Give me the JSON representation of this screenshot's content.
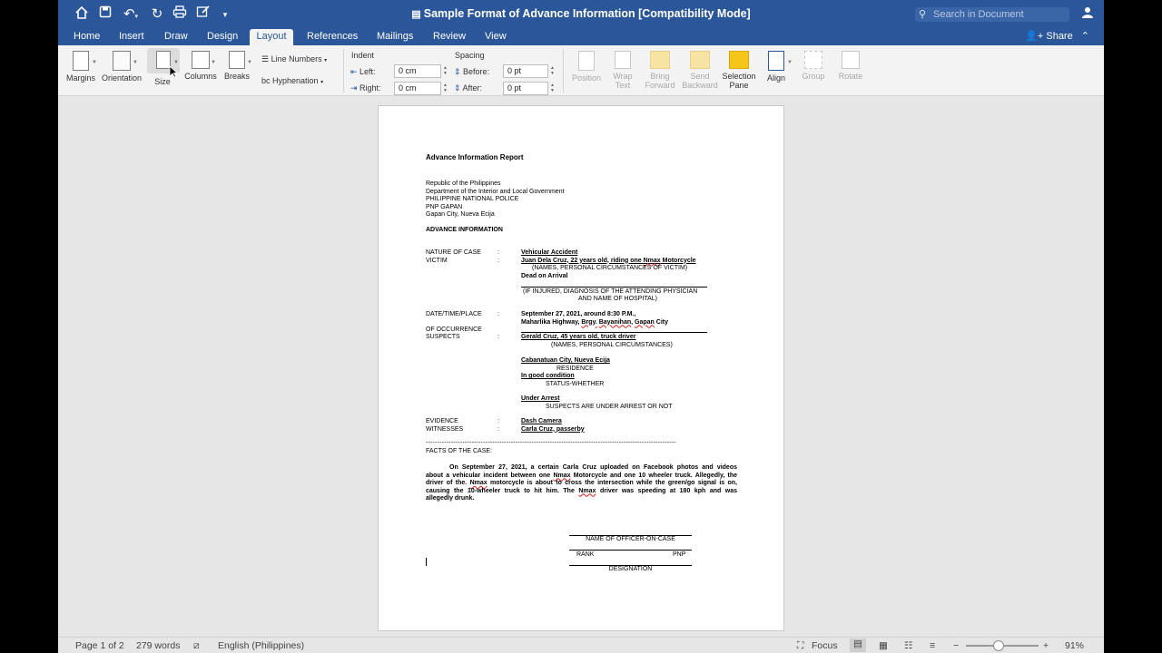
{
  "titlebar": {
    "doc_title": "Sample Format of Advance Information [Compatibility Mode]",
    "search_placeholder": "Search in Document"
  },
  "tabs": [
    {
      "label": "Home"
    },
    {
      "label": "Insert"
    },
    {
      "label": "Draw"
    },
    {
      "label": "Design"
    },
    {
      "label": "Layout",
      "active": true
    },
    {
      "label": "References"
    },
    {
      "label": "Mailings"
    },
    {
      "label": "Review"
    },
    {
      "label": "View"
    }
  ],
  "share_label": "Share",
  "ribbon": {
    "margins": "Margins",
    "orientation": "Orientation",
    "size": "Size",
    "columns": "Columns",
    "breaks": "Breaks",
    "line_numbers": "Line Numbers",
    "hyphenation": "Hyphenation",
    "indent": {
      "title": "Indent",
      "left_label": "Left:",
      "left_value": "0 cm",
      "right_label": "Right:",
      "right_value": "0 cm"
    },
    "spacing": {
      "title": "Spacing",
      "before_label": "Before:",
      "before_value": "0 pt",
      "after_label": "After:",
      "after_value": "0 pt"
    },
    "position": "Position",
    "wrap_text_1": "Wrap",
    "wrap_text_2": "Text",
    "bring_forward_1": "Bring",
    "bring_forward_2": "Forward",
    "send_backward_1": "Send",
    "send_backward_2": "Backward",
    "selection_pane_1": "Selection",
    "selection_pane_2": "Pane",
    "align": "Align",
    "group": "Group",
    "rotate": "Rotate"
  },
  "document": {
    "heading": "Advance Information Report",
    "address": [
      "Republic of the Philippines",
      "Department of the Interior and Local Government",
      "PHILIPPINE NATIONAL POLICE",
      "PNP GAPAN",
      "Gapan City, Nueva Ecija"
    ],
    "section_title": "ADVANCE INFORMATION",
    "colon": ":",
    "nature_label": "NATURE OF CASE",
    "nature_value": "Vehicular Accident",
    "victim_label": "VICTIM",
    "victim_value_a": "Juan Dela Cruz, 22 years old, riding one ",
    "nmax": "Nmax",
    "victim_value_b": " Motorcycle",
    "victim_caption": "(NAMES, PERSONAL CIRCUMSTANCES OF VICTIM)",
    "victim_status": "Dead on Arrival",
    "injury_caption_1": "(IF INJURED, DIAGNOSIS OF THE ATTENDING PHYSICIAN",
    "injury_caption_2": "AND NAME OF HOSPITAL)",
    "dtp_label": "DATE/TIME/PLACE",
    "dtp_value_1": "September 27, 2021, around 8:30 P.M.,",
    "dtp_value_2a": "Maharlika Highway, ",
    "brgy": "Brgy.",
    "bayanihan": "Bayanihan",
    "gapan": "Gapan",
    "dtp_value_2b": " City",
    "occurrence_label": "OF OCCURRENCE",
    "suspects_label": "SUSPECTS",
    "suspects_value": "Gerald Cruz, 45 years old, truck driver",
    "suspects_caption": "(NAMES, PERSONAL CIRCUMSTANCES)",
    "residence_value": "Cabanatuan City, Nueva Ecija",
    "residence_caption": "RESIDENCE",
    "condition_value": "In good condition",
    "condition_caption": "STATUS-WHETHER",
    "arrest_value": "Under Arrest",
    "arrest_caption": "SUSPECTS ARE UNDER ARREST OR NOT",
    "evidence_label": "EVIDENCE",
    "evidence_value": "Dash Camera",
    "witnesses_label": "WITNESSES",
    "witnesses_value": "Carla Cruz, passerby",
    "dashes": "-------------------------------------------------------------------------------------------------------------",
    "facts_label": "FACTS OF THE CASE:",
    "facts_line_1": "On September 27, 2021, a certain Carla Cruz uploaded on Facebook photos and videos",
    "facts_line_2a": "about a vehicular incident between one ",
    "facts_line_2b": " Motorcycle and one 10 wheeler truck. Allegedly, the",
    "facts_line_3a": "driver of the. ",
    "facts_line_3b": " motorcycle is about to cross the intersection while the green/go signal is on,",
    "facts_line_4a": "causing the 10-wheeler truck to hit him. The ",
    "facts_line_4b": " driver was speeding at 180 kph and was",
    "facts_line_5": "allegedly drunk.",
    "officer_caption": "NAME OF OFFICER-ON-CASE",
    "rank_caption": "RANK",
    "pnp_caption": "PNP",
    "designation_caption": "DESIGNATION"
  },
  "status": {
    "page": "Page 1 of 2",
    "words": "279 words",
    "language": "English (Philippines)",
    "focus": "Focus",
    "zoom": "91%",
    "zoom_minus": "−",
    "zoom_plus": "+"
  }
}
